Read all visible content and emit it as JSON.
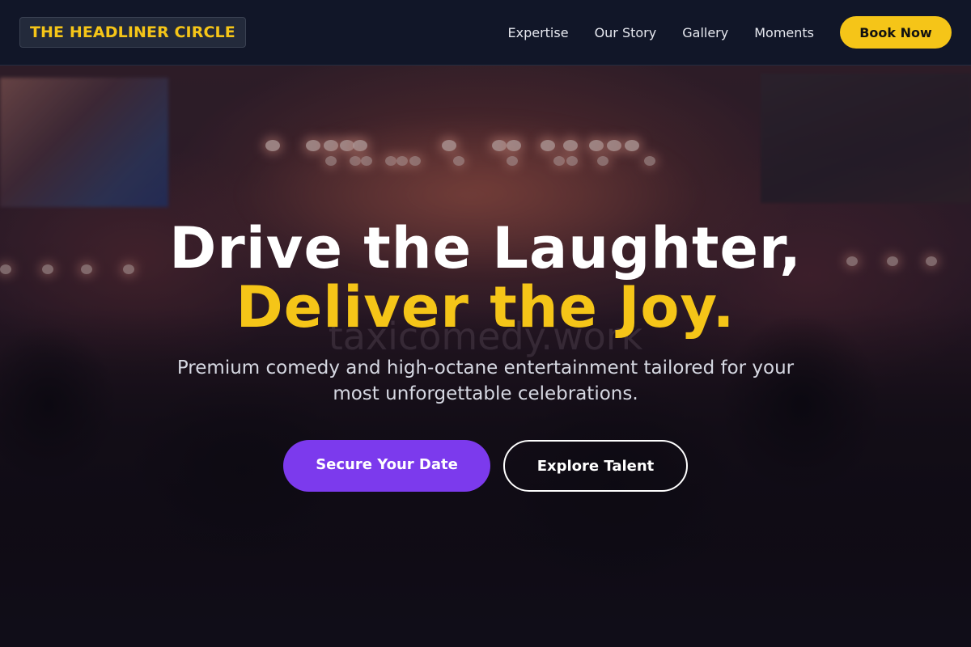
{
  "brand": {
    "logo_text": "THE HEADLINER CIRCLE",
    "accent_color": "#f5c518",
    "primary_color": "#7c3aed"
  },
  "nav": {
    "links": [
      "Expertise",
      "Our Story",
      "Gallery",
      "Moments"
    ],
    "cta_label": "Book Now"
  },
  "hero": {
    "headline_line1": "Drive the Laughter,",
    "headline_line2": "Deliver the Joy.",
    "watermark": "taxicomedy.work",
    "subtitle": "Premium comedy and high-octane entertainment tailored for your most unforgettable celebrations.",
    "primary_cta": "Secure Your Date",
    "secondary_cta": "Explore Talent"
  }
}
